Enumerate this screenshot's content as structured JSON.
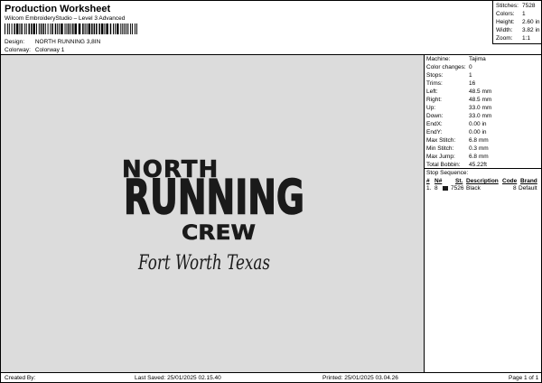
{
  "header": {
    "title": "Production Worksheet",
    "subtitle": "Wilcom EmbroideryStudio – Level 3 Advanced",
    "design_label": "Design:",
    "design_value": "NORTH RUNNING 3,8IN",
    "colorway_label": "Colorway:",
    "colorway_value": "Colorway 1"
  },
  "header_stats": [
    {
      "key": "Stitches:",
      "value": "7528"
    },
    {
      "key": "Colors:",
      "value": "1"
    },
    {
      "key": "Height:",
      "value": "2.60 in"
    },
    {
      "key": "Width:",
      "value": "3.82 in"
    },
    {
      "key": "Zoom:",
      "value": "1:1"
    }
  ],
  "design_art": {
    "line1": "NORTH",
    "line2": "RUNNING",
    "line3": "CREW",
    "line4": "Fort Worth Texas",
    "thread_color": "#1a1a1a"
  },
  "machine": [
    {
      "key": "Machine:",
      "value": "Tajima"
    },
    {
      "key": "Color changes:",
      "value": "0"
    },
    {
      "key": "Stops:",
      "value": "1"
    },
    {
      "key": "Trims:",
      "value": "16"
    },
    {
      "key": "Left:",
      "value": "48.5 mm"
    },
    {
      "key": "Right:",
      "value": "48.5 mm"
    },
    {
      "key": "Up:",
      "value": "33.0 mm"
    },
    {
      "key": "Down:",
      "value": "33.0 mm"
    },
    {
      "key": "EndX:",
      "value": "0.00 in"
    },
    {
      "key": "EndY:",
      "value": "0.00 in"
    },
    {
      "key": "Max Stitch:",
      "value": "6.8 mm"
    },
    {
      "key": "Min Stitch:",
      "value": "0.3 mm"
    },
    {
      "key": "Max Jump:",
      "value": "6.8 mm"
    },
    {
      "key": "Total Bobbin:",
      "value": "45.22ft"
    }
  ],
  "stop_sequence": {
    "title": "Stop Sequence:",
    "headers": {
      "hash": "#",
      "n": "N#",
      "st": "St.",
      "description": "Description",
      "code": "Code",
      "brand": "Brand"
    },
    "rows": [
      {
        "index": "1.",
        "n": "8",
        "st": "7526",
        "description": "Black",
        "code": "8",
        "brand": "Default",
        "color": "#1a1a1a"
      }
    ]
  },
  "footer": {
    "created_by": "Created By:",
    "last_saved": "Last Saved: 25/01/2025 02.15.40",
    "printed": "Printed: 25/01/2025 03.04.26",
    "page": "Page 1 of 1"
  }
}
